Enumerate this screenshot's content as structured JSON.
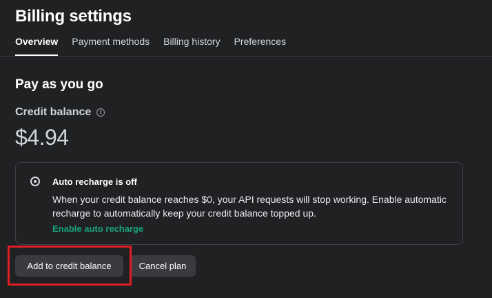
{
  "header": {
    "title": "Billing settings",
    "tabs": [
      {
        "label": "Overview",
        "active": true
      },
      {
        "label": "Payment methods",
        "active": false
      },
      {
        "label": "Billing history",
        "active": false
      },
      {
        "label": "Preferences",
        "active": false
      }
    ]
  },
  "main": {
    "section_title": "Pay as you go",
    "credit_balance_label": "Credit balance",
    "credit_balance_value": "$4.94",
    "auto_recharge": {
      "title": "Auto recharge is off",
      "description": "When your credit balance reaches $0, your API requests will stop working. Enable automatic recharge to automatically keep your credit balance topped up.",
      "link_label": "Enable auto recharge"
    },
    "buttons": {
      "add_credit": "Add to credit balance",
      "cancel_plan": "Cancel plan"
    }
  },
  "icons": {
    "info": "info-icon",
    "radio": "radio-icon"
  },
  "colors": {
    "background": "#202123",
    "accent_link": "#19a37d",
    "highlight": "#e01e25",
    "button_bg": "#3a3b40"
  }
}
